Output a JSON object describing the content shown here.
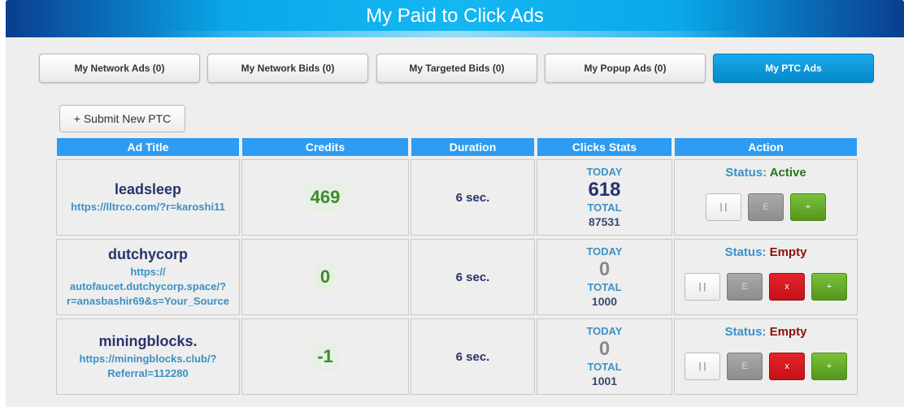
{
  "title": "My Paid to Click Ads",
  "tabs": [
    {
      "label": "My Network Ads (0)"
    },
    {
      "label": "My Network Bids (0)"
    },
    {
      "label": "My Targeted Bids (0)"
    },
    {
      "label": "My Popup Ads (0)"
    },
    {
      "label": "My PTC Ads",
      "active": true
    }
  ],
  "submit_label": "+ Submit New PTC",
  "columns": [
    "Ad Title",
    "Credits",
    "Duration",
    "Clicks Stats",
    "Action"
  ],
  "labels": {
    "today": "TODAY",
    "total": "TOTAL",
    "status": "Status:",
    "pause": "| |",
    "edit": "E",
    "delete": "x",
    "add": "+"
  },
  "rows": [
    {
      "name": "leadsleep",
      "url_lines": [
        "https://lltrco.com/?r=karoshi11"
      ],
      "credits": "469",
      "duration": "6 sec.",
      "today": "618",
      "total": "87531",
      "status": "Active"
    },
    {
      "name": "dutchycorp",
      "url_lines": [
        "https://",
        "autofaucet.dutchycorp.space/?",
        "r=anasbashir69&s=Your_Source"
      ],
      "credits": "0",
      "duration": "6 sec.",
      "today": "0",
      "total": "1000",
      "status": "Empty"
    },
    {
      "name": "miningblocks.",
      "url_lines": [
        "https://miningblocks.club/?",
        "Referral=112280"
      ],
      "credits": "-1",
      "duration": "6 sec.",
      "today": "0",
      "total": "1001",
      "status": "Empty"
    }
  ],
  "colors": {
    "header_gradient": [
      "#0a3d8f",
      "#14b7f2"
    ],
    "table_header": "#2d9cf2",
    "active_tab": "#0489c9",
    "credit_green": "#3f8a2f",
    "status_active": "#227a19",
    "status_empty": "#8b1010",
    "delete_red": "#c41219",
    "add_green": "#54961d"
  }
}
